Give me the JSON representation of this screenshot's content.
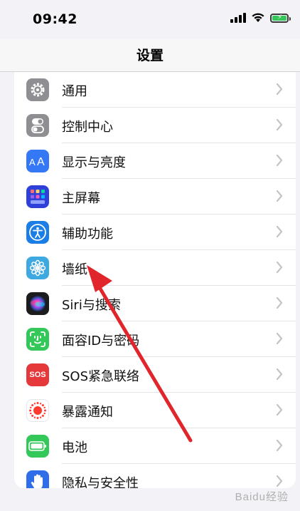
{
  "status_bar": {
    "time": "09:42"
  },
  "nav": {
    "title": "设置"
  },
  "items": [
    {
      "label": "通用",
      "icon": "gear-icon",
      "color": "#8e8e93"
    },
    {
      "label": "控制中心",
      "icon": "toggles-icon",
      "color": "#8e8e93"
    },
    {
      "label": "显示与亮度",
      "icon": "text-size-icon",
      "color": "#3478f6"
    },
    {
      "label": "主屏幕",
      "icon": "home-grid-icon",
      "color": "#2f3fd9"
    },
    {
      "label": "辅助功能",
      "icon": "accessibility-icon",
      "color": "#1a7ee6"
    },
    {
      "label": "墙纸",
      "icon": "flower-icon",
      "color": "#3ea8e0"
    },
    {
      "label": "Siri与搜索",
      "icon": "siri-icon",
      "color": "#1c1c1e"
    },
    {
      "label": "面容ID与密码",
      "icon": "face-id-icon",
      "color": "#34c759"
    },
    {
      "label": "SOS紧急联络",
      "icon": "sos-icon",
      "color": "#e5383b",
      "icon_text": "SOS"
    },
    {
      "label": "暴露通知",
      "icon": "exposure-icon",
      "color": "#ffffff"
    },
    {
      "label": "电池",
      "icon": "battery-icon",
      "color": "#34c759"
    },
    {
      "label": "隐私与安全性",
      "icon": "hand-icon",
      "color": "#2f6ee8"
    }
  ],
  "watermark": "Baidu经验"
}
